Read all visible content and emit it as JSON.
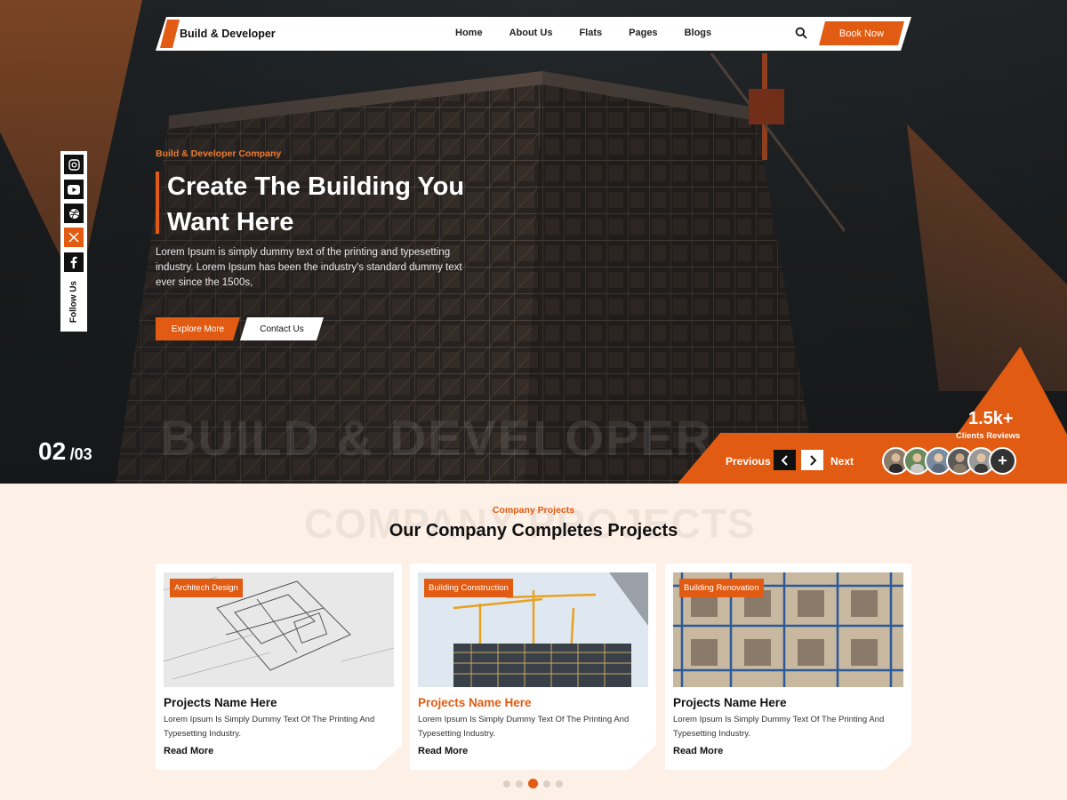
{
  "navbar": {
    "brand": "Build & Developer",
    "links": [
      "Home",
      "About Us",
      "Flats",
      "Pages",
      "Blogs"
    ],
    "book_label": "Book Now"
  },
  "social": {
    "icons": [
      "instagram-icon",
      "youtube-icon",
      "dribbble-icon",
      "x-icon",
      "facebook-icon"
    ],
    "follow_label": "Follow Us"
  },
  "hero": {
    "kicker": "Build & Developer Company",
    "title_line1": "Create The Building You",
    "title_line2": "Want Here",
    "description": "Lorem Ipsum is simply dummy text of the printing and typesetting industry. Lorem Ipsum has been the industry's standard dummy text ever since the 1500s,",
    "explore_label": "Explore More",
    "contact_label": "Contact Us",
    "watermark": "BUILD & DEVELOPER",
    "slide_current": "02",
    "slide_total": "/03",
    "reviews_count": "1.5k+",
    "reviews_label": "Clients Reviews",
    "prev_label": "Previous",
    "next_label": "Next"
  },
  "projects": {
    "watermark": "COMPANY PROJECTS",
    "kicker": "Company Projects",
    "title": "Our Company Completes Projects",
    "cards": [
      {
        "tag": "Architech Design",
        "title": "Projects Name Here",
        "desc": "Lorem Ipsum Is Simply Dummy Text Of The Printing And Typesetting Industry.",
        "link": "Read More"
      },
      {
        "tag": "Building Construction",
        "title": "Projects Name Here",
        "desc": "Lorem Ipsum Is Simply Dummy Text Of The Printing And Typesetting Industry.",
        "link": "Read More"
      },
      {
        "tag": "Building Renovation",
        "title": "Projects Name Here",
        "desc": "Lorem Ipsum Is Simply Dummy Text Of The Printing And Typesetting Industry.",
        "link": "Read More"
      }
    ],
    "active_dot": 3,
    "dot_count": 5
  },
  "colors": {
    "accent": "#e25b12",
    "hero_dark": "#1d2022",
    "section_bg": "#fdf0e6"
  }
}
